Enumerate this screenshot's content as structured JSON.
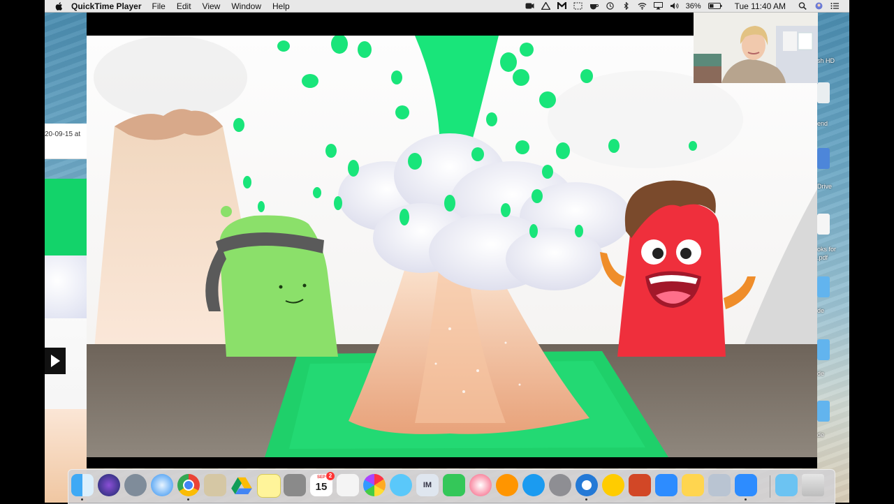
{
  "menubar": {
    "app_name": "QuickTime Player",
    "menus": [
      "File",
      "Edit",
      "View",
      "Window",
      "Help"
    ],
    "battery": "36%",
    "clock": "Tue 11:40 AM"
  },
  "desktop": {
    "stray_text": "20-09-15 at",
    "right_labels": [
      "sh HD",
      "end",
      "Drive",
      "oks for",
      ".pdf",
      "de",
      "de",
      "de"
    ]
  },
  "dock": {
    "calendar_month": "SEP",
    "calendar_day": "15",
    "reminders_badge": "2",
    "imovie_label": "IM"
  },
  "colors": {
    "slime_green": "#19e57a",
    "red_monster": "#ef2f3c",
    "green_monster": "#8be06a",
    "table_brown": "#6c6258"
  }
}
